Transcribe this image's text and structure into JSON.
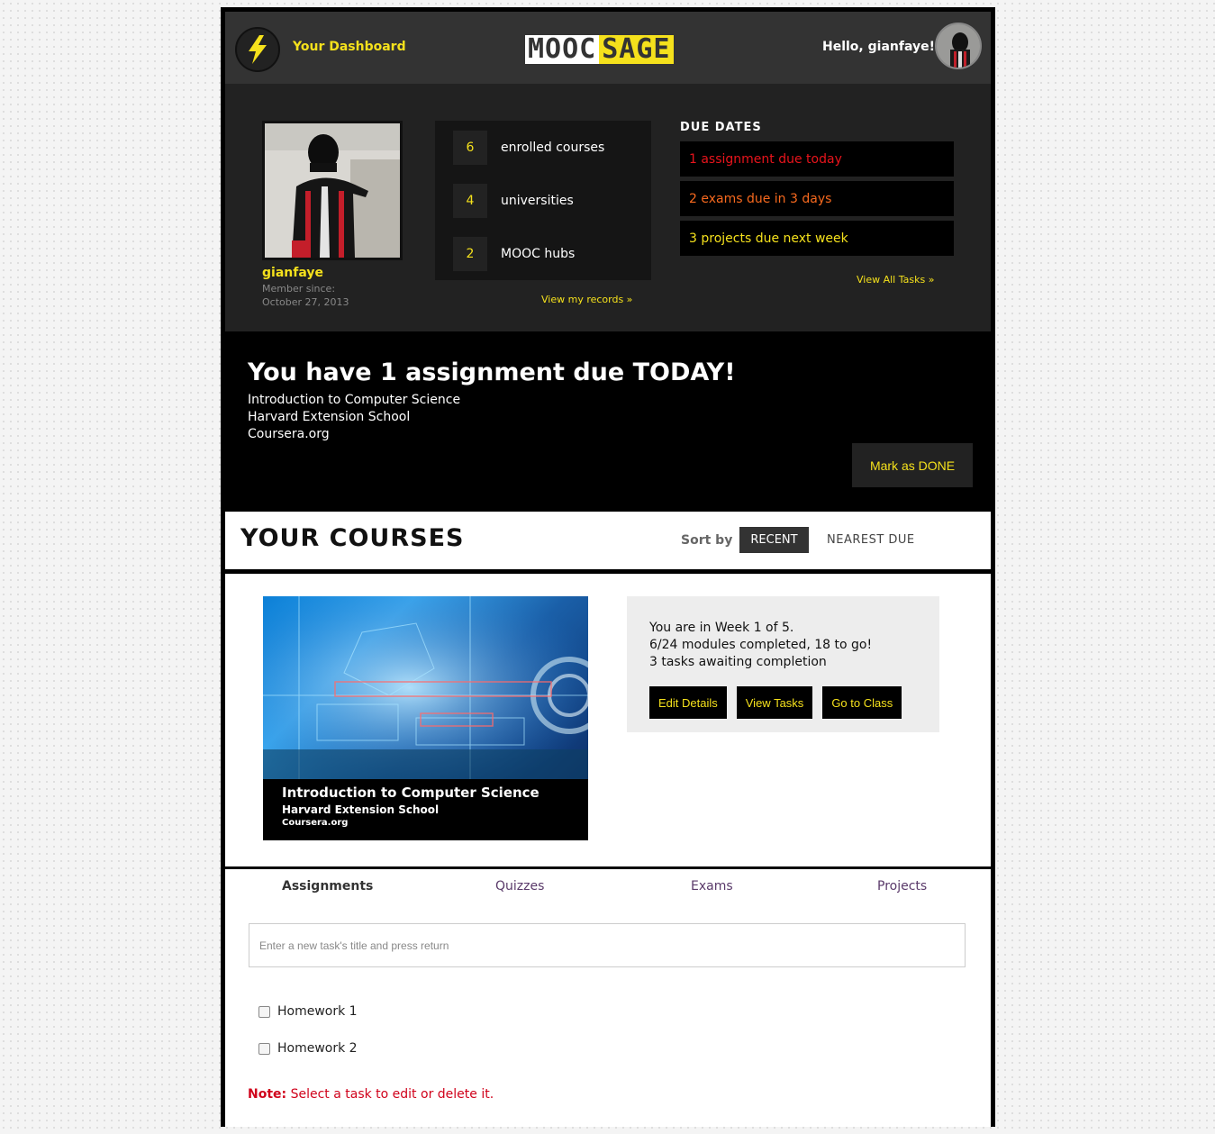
{
  "header": {
    "dashboard_link": "Your Dashboard",
    "logo_part1": "MOOC",
    "logo_part2": "SAGE",
    "greeting": "Hello, gianfaye!"
  },
  "profile": {
    "username": "gianfaye",
    "member_since_label": "Member since:",
    "member_since_date": "October 27, 2013",
    "stats": [
      {
        "value": "6",
        "label": "enrolled courses"
      },
      {
        "value": "4",
        "label": "universities"
      },
      {
        "value": "2",
        "label": "MOOC hubs"
      }
    ],
    "records_link": "View my records »"
  },
  "due_dates": {
    "title": "DUE DATES",
    "items": [
      {
        "text": "1 assignment due today",
        "color": "#e8141c"
      },
      {
        "text": "2 exams due in 3 days",
        "color": "#f7691e"
      },
      {
        "text": "3 projects due next week",
        "color": "#f5e11c"
      }
    ],
    "view_all": "View All Tasks »"
  },
  "alert": {
    "title": "You have 1 assignment due TODAY!",
    "course": "Introduction to Computer Science",
    "school": "Harvard Extension School",
    "platform": "Coursera.org",
    "done_button": "Mark as DONE"
  },
  "courses": {
    "title": "YOUR COURSES",
    "sort_label": "Sort by",
    "sort_recent": "RECENT",
    "sort_nearest": "NEAREST DUE",
    "card": {
      "title": "Introduction to Computer Science",
      "school": "Harvard Extension School",
      "platform": "Coursera.org",
      "week_text": "You are in Week 1 of 5.",
      "modules_text": "6/24 modules completed, 18 to go!",
      "tasks_text": "3 tasks awaiting completion",
      "edit_button": "Edit Details",
      "view_button": "View Tasks",
      "class_button": "Go to Class"
    }
  },
  "tasks": {
    "tabs": [
      "Assignments",
      "Quizzes",
      "Exams",
      "Projects"
    ],
    "input_placeholder": "Enter a new task's title and press return",
    "items": [
      "Homework 1",
      "Homework 2"
    ],
    "note_label": "Note:",
    "note_text": "Select a task to edit or delete it."
  },
  "colors": {
    "accent": "#f5e11c",
    "header_bg": "#333333",
    "panel_bg": "#222222",
    "note": "#d0021b"
  }
}
